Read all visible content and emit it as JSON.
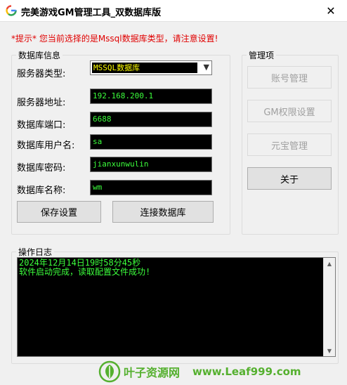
{
  "window": {
    "title": "完美游戏GM管理工具_双数据库版",
    "close_glyph": "✕"
  },
  "warning": "*提示*  您当前选择的是Mssql数据库类型，请注意设置!",
  "db_group": {
    "legend": "数据库信息",
    "server_type_label": "服务器类型:",
    "server_type_value": "MSSQL数据库",
    "server_addr_label": "服务器地址:",
    "server_addr_value": "192.168.200.1",
    "port_label": "数据库端口:",
    "port_value": "6688",
    "user_label": "数据库用户名:",
    "user_value": "sa",
    "password_label": "数据库密码:",
    "password_value": "jianxunwulin",
    "dbname_label": "数据库名称:",
    "dbname_value": "wm",
    "save_button": "保存设置",
    "connect_button": "连接数据库"
  },
  "manage_group": {
    "legend": "管理项",
    "account_button": "账号管理",
    "gm_perm_button": "GM权限设置",
    "yuanbao_button": "元宝管理",
    "about_button": "关于"
  },
  "log_group": {
    "legend": "操作日志",
    "lines": [
      "2024年12月14日19时58分45秒",
      "软件启动完成，读取配置文件成功!"
    ]
  },
  "watermark": {
    "site_cn": "叶子资源网",
    "site_url": "www.Leaf999.com"
  },
  "colors": {
    "field_text": "#3cff3c",
    "select_text": "#ffff00",
    "warning": "#e00000",
    "watermark": "#55b02f"
  }
}
